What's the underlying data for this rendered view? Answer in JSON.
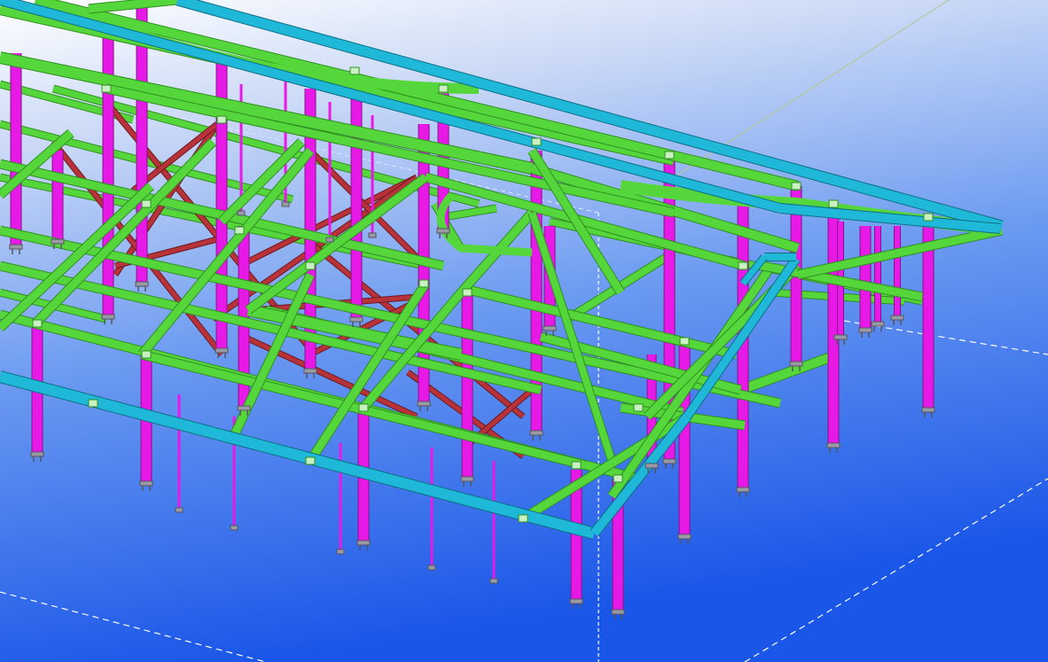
{
  "viewport": {
    "view_type": "3D isometric structural model view",
    "background_gradient": [
      "#ffffff",
      "#c9d8f6",
      "#6b9af1",
      "#1a56e8"
    ]
  },
  "member_colors": {
    "beam": "#55d63a",
    "beam_dark": "#2f8f22",
    "column": "#e619e6",
    "column_dark": "#8a0f8a",
    "edge_beam": "#1fb8d8",
    "edge_beam_dark": "#0e6f86",
    "bracing": "#b8323a",
    "baseplate": "#9a9aa6",
    "work_area_line": "#ffffff",
    "grid_line": "#b4c79a"
  },
  "model": {
    "member_types": [
      "beam",
      "column",
      "edge-beam",
      "bracing",
      "baseplate",
      "hanger-rod"
    ]
  }
}
